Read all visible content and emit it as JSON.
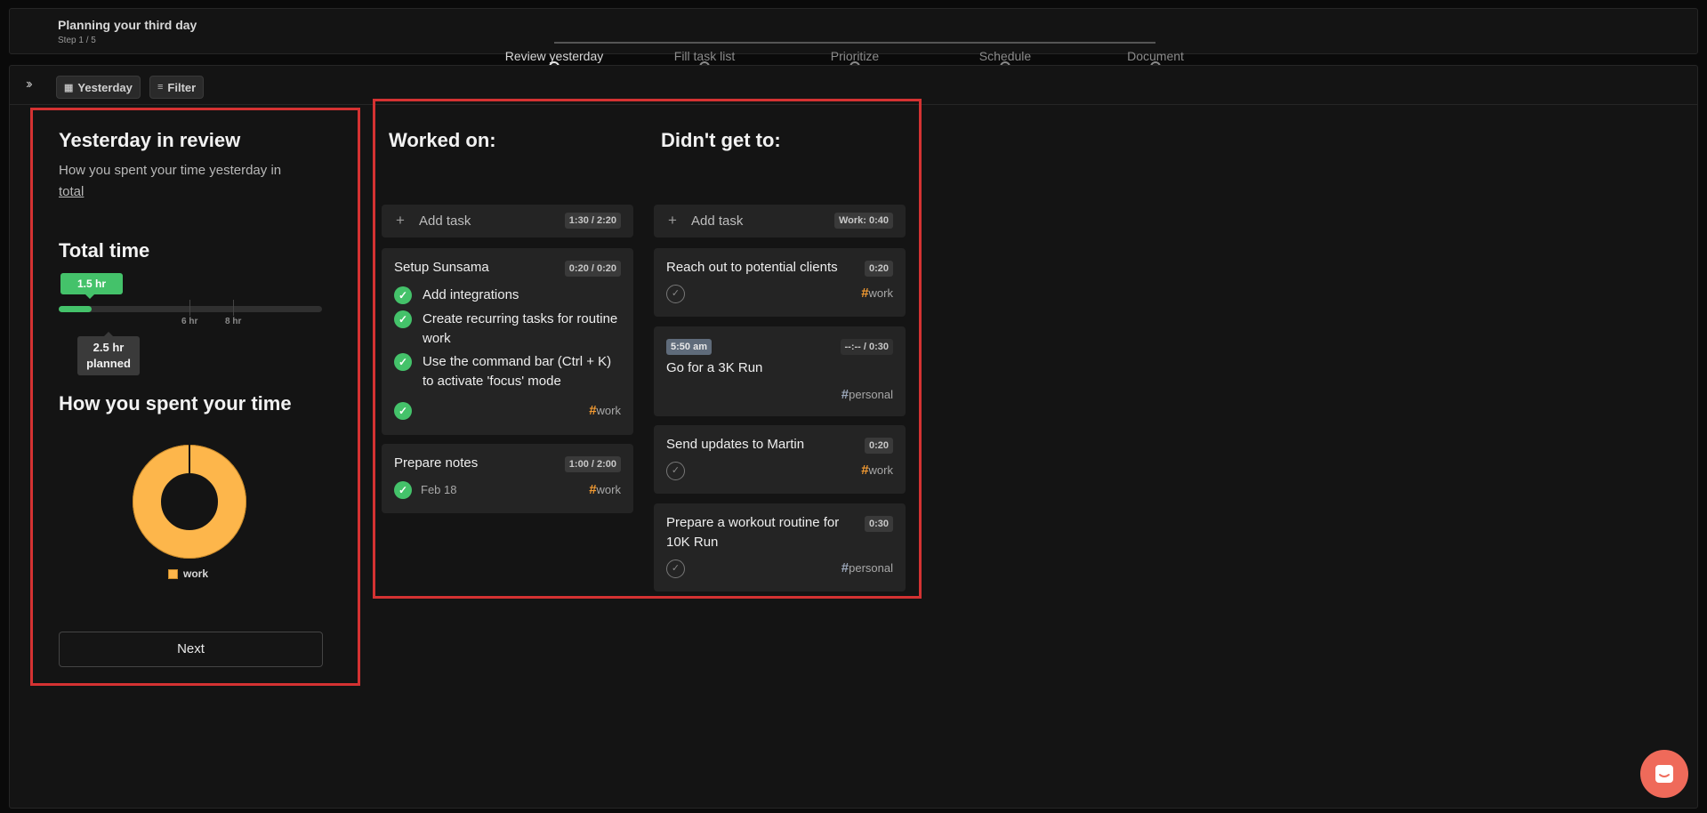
{
  "header": {
    "title": "Planning your third day",
    "step": "Step 1 / 5",
    "steps": [
      {
        "label": "Review yesterday",
        "active": true
      },
      {
        "label": "Fill task list",
        "active": false
      },
      {
        "label": "Prioritize",
        "active": false
      },
      {
        "label": "Schedule",
        "active": false
      },
      {
        "label": "Document",
        "active": false
      }
    ]
  },
  "toolbar": {
    "expand_icon": "double-chevron-right-icon",
    "date_chip": "Yesterday",
    "filter_chip": "Filter"
  },
  "review": {
    "title": "Yesterday in review",
    "description": "How you spent your time yesterday in",
    "description_link": "total",
    "total_time_heading": "Total time",
    "actual_time": "1.5 hr",
    "progress_fraction": 0.125,
    "tick_6": "6 hr",
    "tick_8": "8 hr",
    "planned_value": "2.5 hr",
    "planned_label": "planned",
    "spent_heading": "How you spent your time",
    "legend_label": "work",
    "next_button": "Next"
  },
  "chart_data": {
    "type": "pie",
    "categories": [
      "work"
    ],
    "values": [
      100
    ],
    "colors": [
      "#fdb64b"
    ]
  },
  "worked_on": {
    "title": "Worked on:",
    "add_task": "Add task",
    "add_task_time": "1:30 / 2:20",
    "tasks": [
      {
        "title": "Setup Sunsama",
        "time": "0:20 / 0:20",
        "subtasks": [
          "Add integrations",
          "Create recurring tasks for routine work",
          "Use the command bar (Ctrl + K) to activate 'focus' mode"
        ],
        "tag": "work"
      },
      {
        "title": "Prepare notes",
        "time": "1:00 / 2:00",
        "date": "Feb 18",
        "tag": "work"
      }
    ]
  },
  "didnt_get_to": {
    "title": "Didn't get to:",
    "add_task": "Add task",
    "add_task_time": "Work: 0:40",
    "tasks": [
      {
        "title": "Reach out to potential clients",
        "time": "0:20",
        "tag": "work"
      },
      {
        "title": "Go for a 3K Run",
        "start": "5:50 am",
        "time": "--:-- / 0:30",
        "tag": "personal"
      },
      {
        "title": "Send updates to Martin",
        "time": "0:20",
        "tag": "work"
      },
      {
        "title": "Prepare a workout routine for 10K Run",
        "time": "0:30",
        "tag": "personal"
      }
    ]
  },
  "colors": {
    "accent_green": "#44c26a",
    "work_orange": "#f39a31",
    "highlight_red": "#d43232",
    "chat_button": "#ef6a5a"
  }
}
